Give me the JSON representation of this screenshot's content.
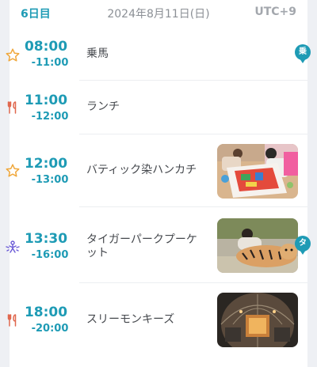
{
  "header": {
    "day": "6日目",
    "date": "2024年8月11日(日)",
    "timezone": "UTC+9"
  },
  "colors": {
    "accent": "#1e9bb5",
    "star": "#f0a83c",
    "food": "#e0684f",
    "activity": "#6a5ad6"
  },
  "items": [
    {
      "icon": "star-icon",
      "start": "08:00",
      "end": "-11:00",
      "title": "乗馬",
      "pin": "乗"
    },
    {
      "icon": "restaurant-icon",
      "start": "11:00",
      "end": "-12:00",
      "title": "ランチ"
    },
    {
      "icon": "star-icon",
      "start": "12:00",
      "end": "-13:00",
      "title": "バティック染ハンカチ",
      "photo": "batik-workshop-photo"
    },
    {
      "icon": "activity-icon",
      "start": "13:30",
      "end": "-16:00",
      "title": "タイガーパークプーケット",
      "photo": "tiger-park-photo",
      "pin": "タ"
    },
    {
      "icon": "restaurant-icon",
      "start": "18:00",
      "end": "-20:00",
      "title": "スリーモンキーズ",
      "photo": "restaurant-dome-photo"
    }
  ]
}
